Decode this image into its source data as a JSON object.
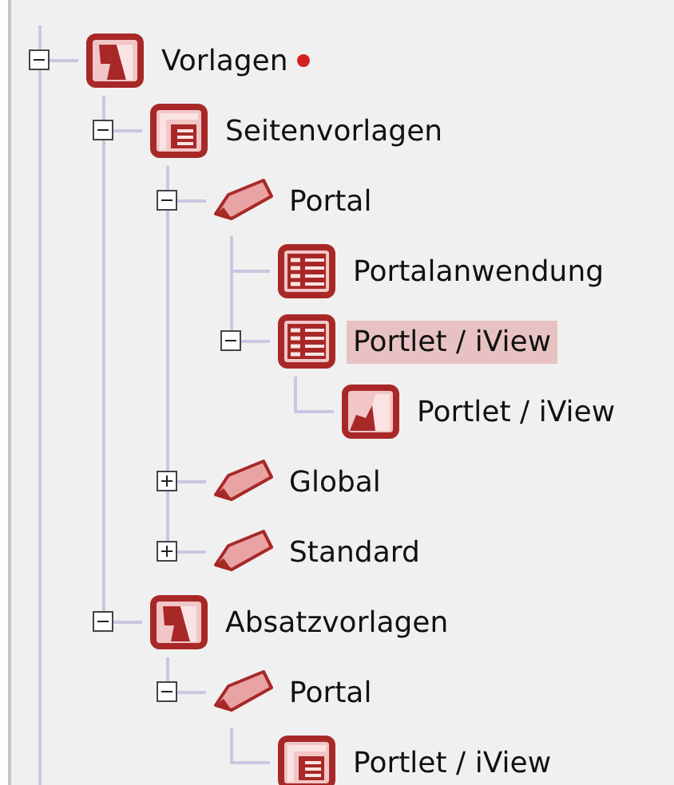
{
  "tree": [
    {
      "label": "Vorlagen",
      "kind": "folder",
      "flagged": true,
      "expanded": true,
      "selected": false,
      "children": [
        {
          "label": "Seitenvorlagen",
          "kind": "template",
          "expanded": true,
          "selected": false,
          "children": [
            {
              "label": "Portal",
              "kind": "tag",
              "expanded": true,
              "selected": false,
              "children": [
                {
                  "label": "Portalanwendung",
                  "kind": "list",
                  "selected": false
                },
                {
                  "label": "Portlet / iView",
                  "kind": "list",
                  "expanded": true,
                  "selected": true,
                  "children": [
                    {
                      "label": "Portlet / iView",
                      "kind": "portlet",
                      "selected": false
                    }
                  ]
                }
              ]
            },
            {
              "label": "Global",
              "kind": "tag",
              "expanded": false,
              "selected": false
            },
            {
              "label": "Standard",
              "kind": "tag",
              "expanded": false,
              "selected": false
            }
          ]
        },
        {
          "label": "Absatzvorlagen",
          "kind": "folder",
          "expanded": true,
          "selected": false,
          "children": [
            {
              "label": "Portal",
              "kind": "tag",
              "expanded": true,
              "selected": false,
              "children": [
                {
                  "label": "Portlet / iView",
                  "kind": "template",
                  "selected": false
                }
              ]
            }
          ]
        }
      ]
    }
  ]
}
